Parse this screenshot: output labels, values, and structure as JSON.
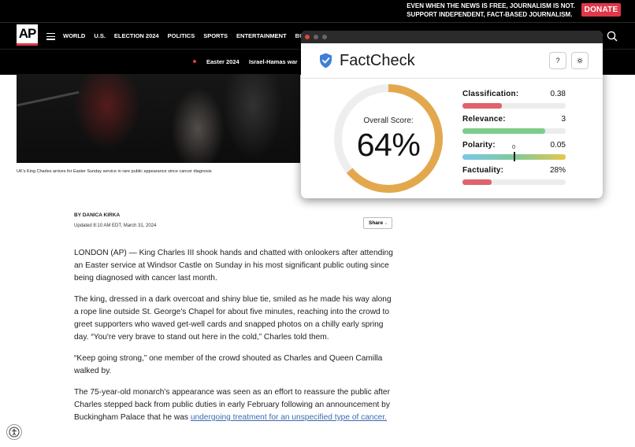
{
  "promo": {
    "line1": "EVEN WHEN THE NEWS IS FREE, JOURNALISM IS NOT.",
    "line2": "SUPPORT INDEPENDENT, FACT-BASED JOURNALISM.",
    "donate_label": "DONATE"
  },
  "nav": {
    "logo": "AP",
    "items": [
      "WORLD",
      "U.S.",
      "ELECTION 2024",
      "POLITICS",
      "SPORTS",
      "ENTERTAINMENT",
      "BUSINES"
    ]
  },
  "subnav": {
    "items": [
      "Easter 2024",
      "Israel-Hamas war"
    ]
  },
  "hero": {
    "caption": "UK's King Charles arrives for Easter Sunday service in rare public appearance since cancer diagnosis"
  },
  "article": {
    "byline": "BY DANICA KIRKA",
    "updated": "Updated 8:10 AM EDT, March 31, 2024",
    "share_label": "Share",
    "paragraphs": [
      "LONDON (AP) — King Charles III shook hands and chatted with onlookers after attending an Easter service at Windsor Castle on Sunday in his most significant public outing since being diagnosed with cancer last month.",
      "The king, dressed in a dark overcoat and shiny blue tie, smiled as he made his way along a rope line outside St. George's Chapel for about five minutes, reaching into the crowd to greet supporters who waved get-well cards and snapped photos on a chilly early spring day. “You're very brave to stand out here in the cold,” Charles told them.",
      "“Keep going strong,” one member of the crowd shouted as Charles and Queen Camilla walked by."
    ],
    "last_paragraph_text": "The 75-year-old monarch's appearance was seen as an effort to reassure the public after Charles stepped back from public duties in early February following an announcement by Buckingham Palace that he was ",
    "last_paragraph_link": "undergoing treatment for an unspecified type of cancer."
  },
  "factcheck": {
    "title": "FactCheck",
    "help_label": "?",
    "overall_label": "Overall Score:",
    "overall_value": "64%",
    "overall_fraction": 0.64,
    "colors": {
      "gauge": "#e3a84e",
      "gauge_track": "#eeeeee",
      "classification": "#e0626a",
      "relevance": "#7ecb8c",
      "factuality": "#e0626a",
      "accent": "#3f7fd6"
    },
    "metrics": {
      "classification": {
        "label": "Classification:",
        "value": "0.38",
        "fraction": 0.38
      },
      "relevance": {
        "label": "Relevance:",
        "value": "3",
        "fraction": 0.8
      },
      "polarity": {
        "label": "Polarity:",
        "value": "0.05",
        "zero_label": "0"
      },
      "factuality": {
        "label": "Factuality:",
        "value": "28%",
        "fraction": 0.28
      }
    }
  }
}
